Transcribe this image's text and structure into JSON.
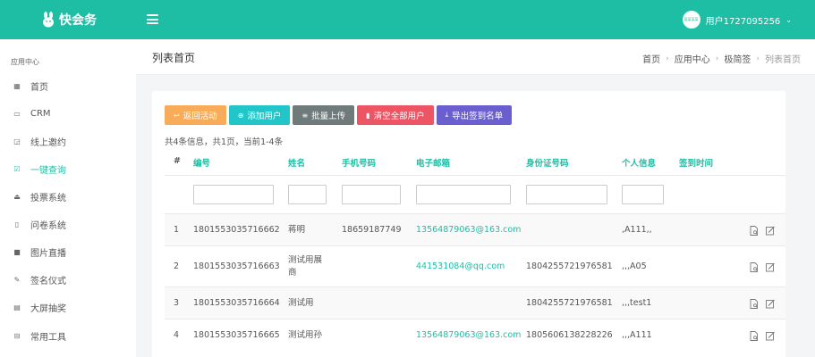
{
  "app": {
    "logo_text": "快会务",
    "user_name": "用户1727095256",
    "avatar_text": "某某某某"
  },
  "sidebar": {
    "heading": "应用中心",
    "items": [
      {
        "label": "首页",
        "icon": "dashboard-icon"
      },
      {
        "label": "CRM",
        "icon": "id-card-icon"
      },
      {
        "label": "线上邀约",
        "icon": "share-icon"
      },
      {
        "label": "一键查询",
        "icon": "check-square-icon",
        "active": true
      },
      {
        "label": "投票系统",
        "icon": "vote-icon"
      },
      {
        "label": "问卷系统",
        "icon": "survey-icon"
      },
      {
        "label": "图片直播",
        "icon": "video-icon"
      },
      {
        "label": "签名仪式",
        "icon": "signature-icon"
      },
      {
        "label": "大屏抽奖",
        "icon": "gift-icon"
      },
      {
        "label": "常用工具",
        "icon": "toolbox-icon"
      }
    ]
  },
  "header": {
    "title": "列表首页",
    "breadcrumb": [
      "首页",
      "应用中心",
      "极简签",
      "列表首页"
    ]
  },
  "toolbar": {
    "back": "返回活动",
    "add_user": "添加用户",
    "batch_upload": "批量上传",
    "clear_all": "清空全部用户",
    "export": "导出签到名单"
  },
  "summary": "共4条信息，共1页，当前1-4条",
  "table": {
    "headers": [
      "#",
      "编号",
      "姓名",
      "手机号码",
      "电子邮箱",
      "身份证号码",
      "个人信息",
      "签到时间"
    ],
    "rows": [
      {
        "idx": "1",
        "code": "1801553035716662",
        "name": "蒋明",
        "phone": "18659187749",
        "email": "13564879063@163.com",
        "id_no": "",
        "info": ",A111,,",
        "time": ""
      },
      {
        "idx": "2",
        "code": "1801553035716663",
        "name_l1": "测试用展",
        "name_l2": "商",
        "phone": "",
        "email": "441531084@qq.com",
        "id_no": "1804255721976581",
        "info": ",,,A05",
        "time": ""
      },
      {
        "idx": "3",
        "code": "1801553035716664",
        "name": "测试用",
        "phone": "",
        "email": "",
        "id_no": "1804255721976581",
        "info": ",,,test1",
        "time": ""
      },
      {
        "idx": "4",
        "code": "1801553035716665",
        "name": "测试用孙",
        "phone": "",
        "email": "13564879063@163.com",
        "id_no": "1805606138228226",
        "info": ",,,A111",
        "time": ""
      }
    ]
  }
}
